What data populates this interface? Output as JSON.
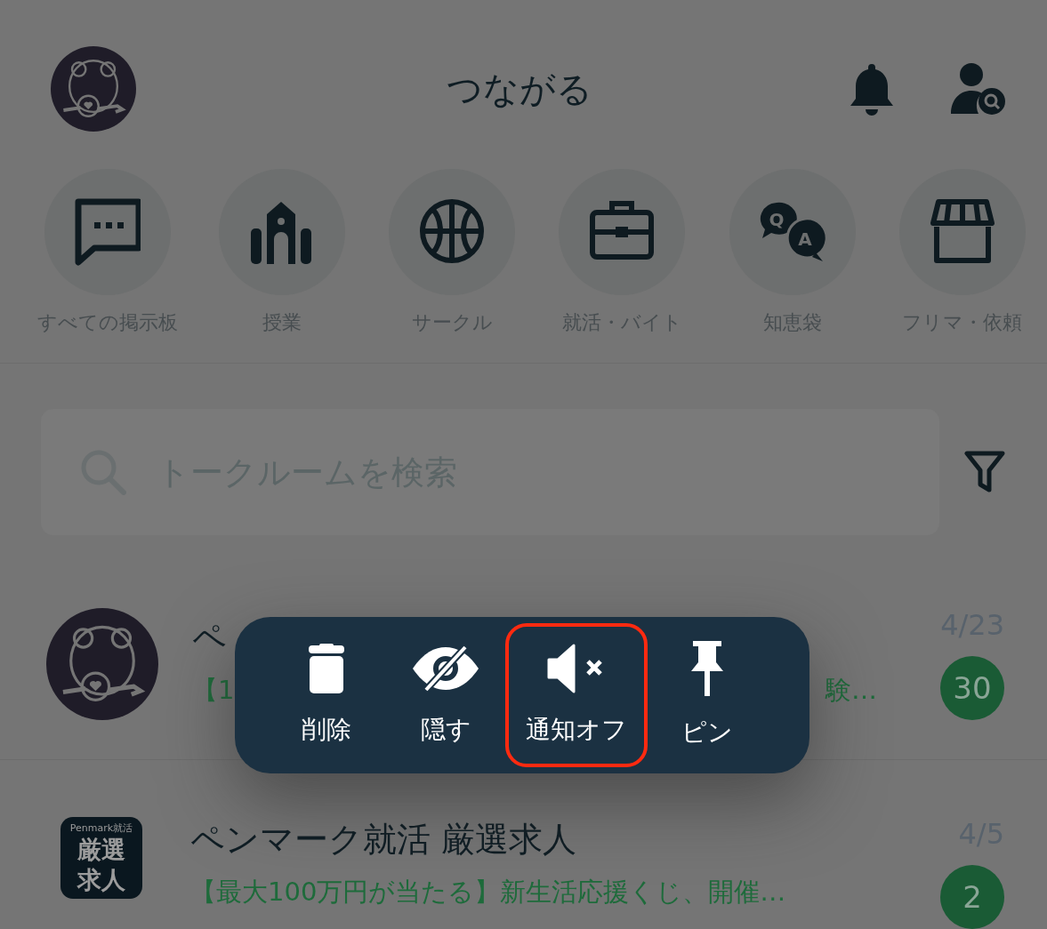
{
  "header": {
    "title": "つながる"
  },
  "categories": [
    {
      "label": "すべての掲示板",
      "kind": "board"
    },
    {
      "label": "授業",
      "kind": "school"
    },
    {
      "label": "サークル",
      "kind": "ball"
    },
    {
      "label": "就活・バイト",
      "kind": "briefcase"
    },
    {
      "label": "知恵袋",
      "kind": "qa",
      "icon_letters": [
        "Q",
        "A"
      ]
    },
    {
      "label": "フリマ・依頼",
      "kind": "shop"
    }
  ],
  "search": {
    "placeholder": "トークルームを検索"
  },
  "rooms": [
    {
      "kind": "bear",
      "title": "ペ",
      "preview": "【1",
      "preview_tail": "験…",
      "date": "4/23",
      "unread": "30"
    },
    {
      "kind": "logo",
      "logo_caption": "Penmark就活",
      "logo_lines": [
        "厳選",
        "求人"
      ],
      "title": "ペンマーク就活 厳選求人",
      "preview": "【最大100万円が当たる】新生活応援くじ、開催…",
      "date": "4/5",
      "unread": "2"
    }
  ],
  "context_menu": {
    "items": [
      {
        "kind": "trash",
        "label": "削除",
        "highlighted": false
      },
      {
        "kind": "hide",
        "label": "隠す",
        "highlighted": false
      },
      {
        "kind": "mute",
        "label": "通知オフ",
        "highlighted": true
      },
      {
        "kind": "pin",
        "label": "ピン",
        "highlighted": false
      }
    ]
  }
}
